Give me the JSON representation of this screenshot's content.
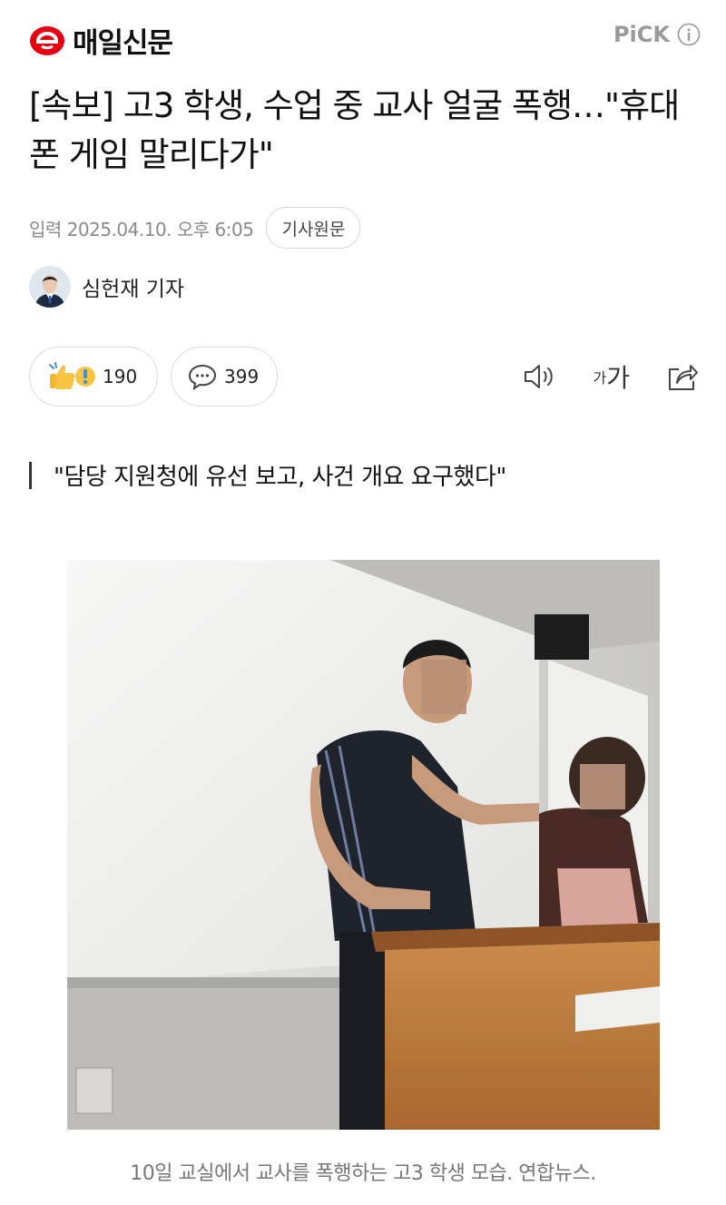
{
  "header": {
    "logo_text": "매일신문",
    "pick_label": "PiCK",
    "info_icon": "info-icon"
  },
  "article": {
    "headline": "[속보] 고3 학생, 수업 중 교사 얼굴 폭행…\"휴대폰 게임 말리다가\"",
    "date": "입력 2025.04.10. 오후 6:05",
    "original_button": "기사원문",
    "reporter_name": "심헌재 기자",
    "subtitle": "\"담당 지원청에 유선 보고, 사건 개요 요구했다\"",
    "caption": "10일 교실에서 교사를 폭행하는 고3 학생 모습. 연합뉴스."
  },
  "actions": {
    "reaction_count": "190",
    "comment_count": "399",
    "reaction_icon": "thumbs-up-exclamation-icon",
    "comment_icon": "speech-bubble-icon",
    "tts_icon": "speaker-icon",
    "font_size_icon": "font-size-icon",
    "font_size_small": "가",
    "font_size_large": "가",
    "share_icon": "share-icon"
  },
  "colors": {
    "brand_red": "#e60012",
    "muted_text": "#8a8a8a",
    "reaction_yellow": "#f6c343",
    "reaction_blue": "#3f8fd8"
  }
}
